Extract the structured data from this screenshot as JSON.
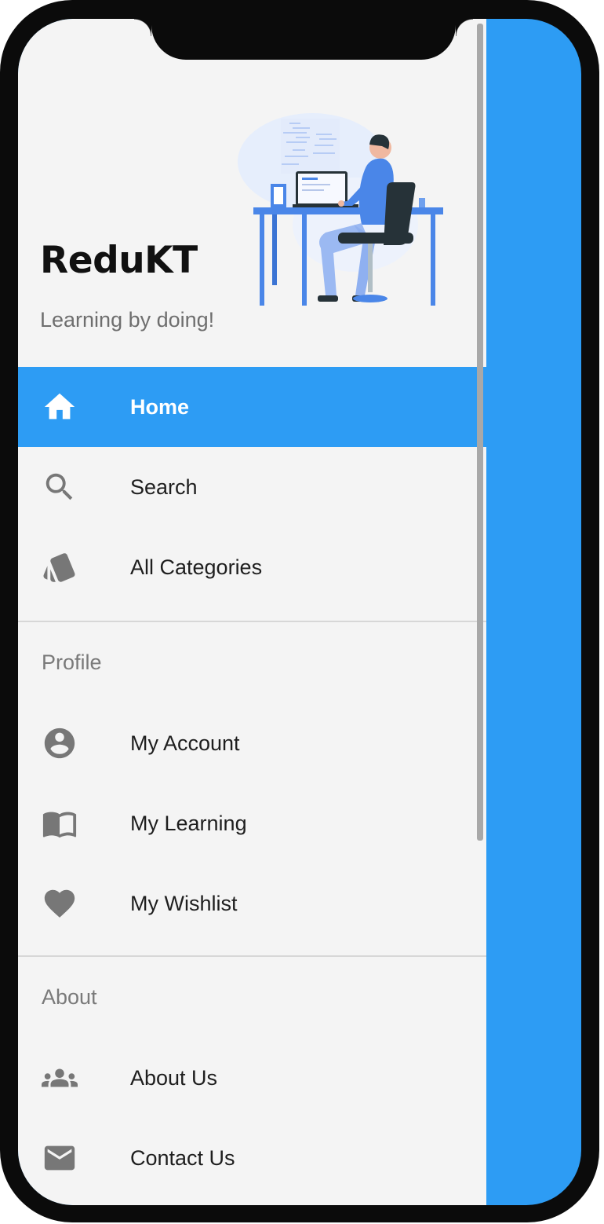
{
  "app": {
    "brand_name": "ReduKT",
    "tagline": "Learning by doing!"
  },
  "colors": {
    "accent": "#2d9cf4",
    "drawer_background": "#f4f4f4",
    "icon": "#777777",
    "text": "#1e1e1e",
    "section_header": "#7a7a7a"
  },
  "drawer": {
    "main_items": [
      {
        "label": "Home",
        "icon": "home-icon",
        "active": true
      },
      {
        "label": "Search",
        "icon": "search-icon",
        "active": false
      },
      {
        "label": "All Categories",
        "icon": "categories-icon",
        "active": false
      }
    ],
    "profile": {
      "header": "Profile",
      "items": [
        {
          "label": "My Account",
          "icon": "account-circle-icon"
        },
        {
          "label": "My Learning",
          "icon": "book-icon"
        },
        {
          "label": "My Wishlist",
          "icon": "heart-icon"
        }
      ]
    },
    "about": {
      "header": "About",
      "items": [
        {
          "label": "About Us",
          "icon": "people-icon"
        },
        {
          "label": "Contact Us",
          "icon": "mail-icon"
        }
      ]
    }
  }
}
